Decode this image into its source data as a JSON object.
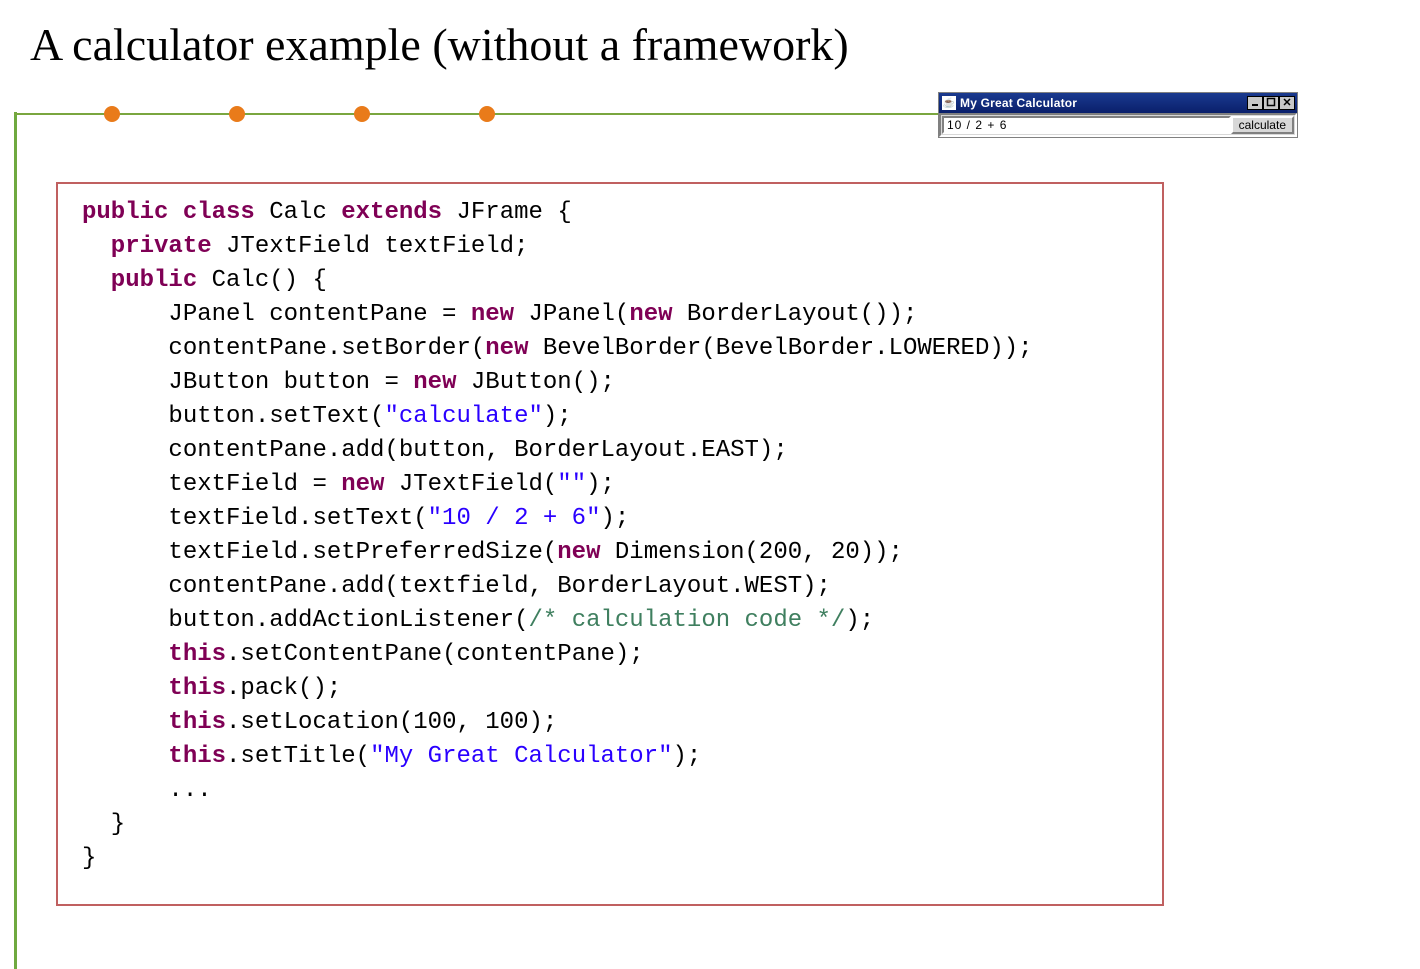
{
  "heading": "A calculator example (without a framework)",
  "calc_window": {
    "title": "My Great Calculator",
    "input_value": "10 / 2 + 6",
    "button_label": "calculate",
    "java_icon_glyph": "☕"
  },
  "code": {
    "l01a": "public",
    "l01b": " class",
    "l01c": " Calc ",
    "l01d": "extends",
    "l01e": " JFrame {",
    "l02a": "  private",
    "l02b": " JTextField textField;",
    "l03a": "  public",
    "l03b": " Calc() {",
    "l04": "      JPanel contentPane = ",
    "l04b": "new",
    "l04c": " JPanel(",
    "l04d": "new",
    "l04e": " BorderLayout());",
    "l05": "      contentPane.setBorder(",
    "l05b": "new",
    "l05c": " BevelBorder(BevelBorder.LOWERED));",
    "l06": "      JButton button = ",
    "l06b": "new",
    "l06c": " JButton();",
    "l07": "      button.setText(",
    "l07s": "\"calculate\"",
    "l07c": ");",
    "l08": "      contentPane.add(button, BorderLayout.EAST);",
    "l09": "      textField = ",
    "l09b": "new",
    "l09c": " JTextField(",
    "l09s": "\"\"",
    "l09d": ");",
    "l10": "      textField.setText(",
    "l10s": "\"10 / 2 + 6\"",
    "l10c": ");",
    "l11": "      textField.setPreferredSize(",
    "l11b": "new",
    "l11c": " Dimension(200, 20));",
    "l12": "      contentPane.add(textfield, BorderLayout.WEST);",
    "l13": "      button.addActionListener(",
    "l13c": "/* calculation code */",
    "l13d": ");",
    "l14": "      this",
    "l14b": ".setContentPane(contentPane);",
    "l15": "      this",
    "l15b": ".pack();",
    "l16": "      this",
    "l16b": ".setLocation(100, 100);",
    "l17": "      this",
    "l17b": ".setTitle(",
    "l17s": "\"My Great Calculator\"",
    "l17c": ");",
    "l18": "      ...",
    "l19": "  }",
    "l20": "}"
  }
}
